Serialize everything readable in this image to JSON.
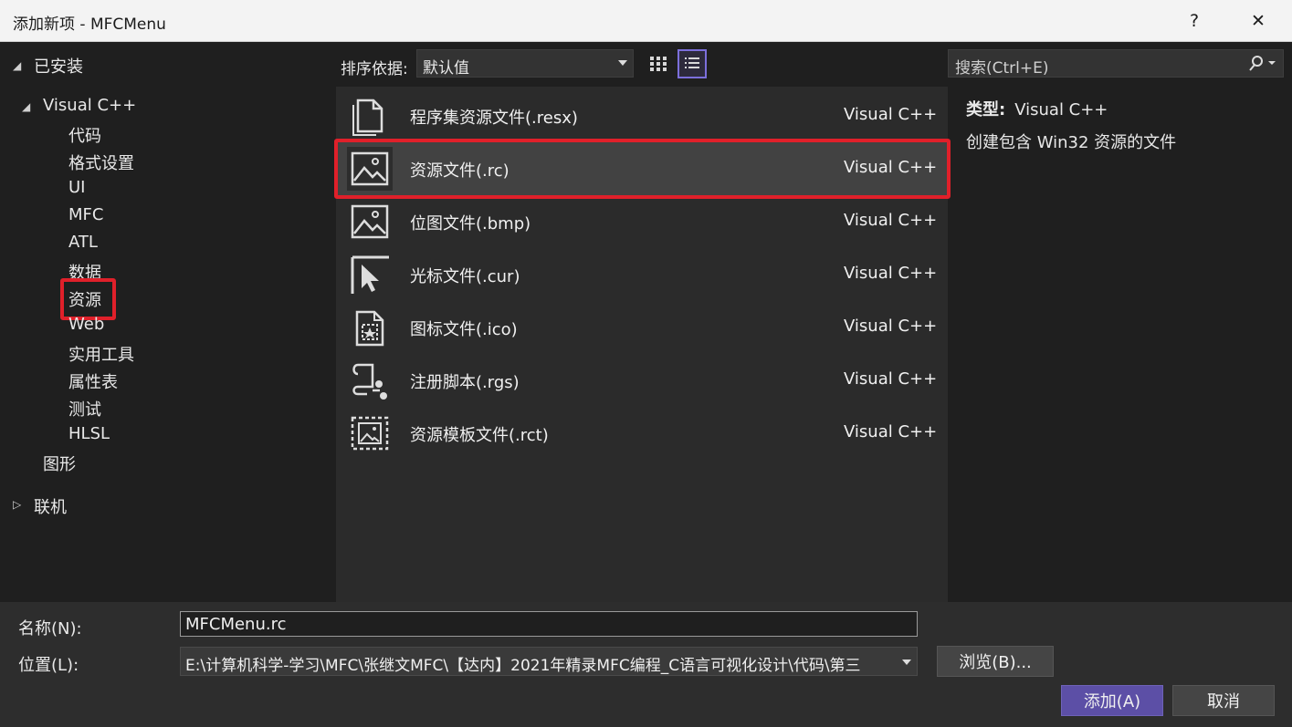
{
  "window": {
    "title": "添加新项 - MFCMenu",
    "help": "?",
    "close": "✕"
  },
  "tree": {
    "installed": "已安装",
    "visual_cpp": "Visual C++",
    "children": [
      "代码",
      "格式设置",
      "UI",
      "MFC",
      "ATL",
      "数据",
      "资源",
      "Web",
      "实用工具",
      "属性表",
      "测试",
      "HLSL"
    ],
    "graphics": "图形",
    "online": "联机",
    "selected": "资源"
  },
  "toolbar": {
    "sort_label": "排序依据:",
    "sort_value": "默认值",
    "search_placeholder": "搜索(Ctrl+E)"
  },
  "items": [
    {
      "name": "程序集资源文件(.resx)",
      "type": "Visual C++",
      "icon": "file-icon"
    },
    {
      "name": "资源文件(.rc)",
      "type": "Visual C++",
      "icon": "image-icon"
    },
    {
      "name": "位图文件(.bmp)",
      "type": "Visual C++",
      "icon": "image-icon"
    },
    {
      "name": "光标文件(.cur)",
      "type": "Visual C++",
      "icon": "cursor-icon"
    },
    {
      "name": "图标文件(.ico)",
      "type": "Visual C++",
      "icon": "ico-file-icon"
    },
    {
      "name": "注册脚本(.rgs)",
      "type": "Visual C++",
      "icon": "script-icon"
    },
    {
      "name": "资源模板文件(.rct)",
      "type": "Visual C++",
      "icon": "template-icon"
    }
  ],
  "selected_item": "资源文件(.rc)",
  "details": {
    "type_label": "类型:",
    "type_value": "Visual C++",
    "description": "创建包含 Win32 资源的文件"
  },
  "form": {
    "name_label": "名称(N):",
    "name_value": "MFCMenu.rc",
    "location_label": "位置(L):",
    "location_value": "E:\\计算机科学-学习\\MFC\\张继文MFC\\【达内】2021年精录MFC编程_C语言可视化设计\\代码\\第三",
    "browse": "浏览(B)...",
    "add": "添加(A)",
    "cancel": "取消"
  },
  "colors": {
    "accent": "#5c4fa6",
    "highlight": "#e0202a"
  }
}
